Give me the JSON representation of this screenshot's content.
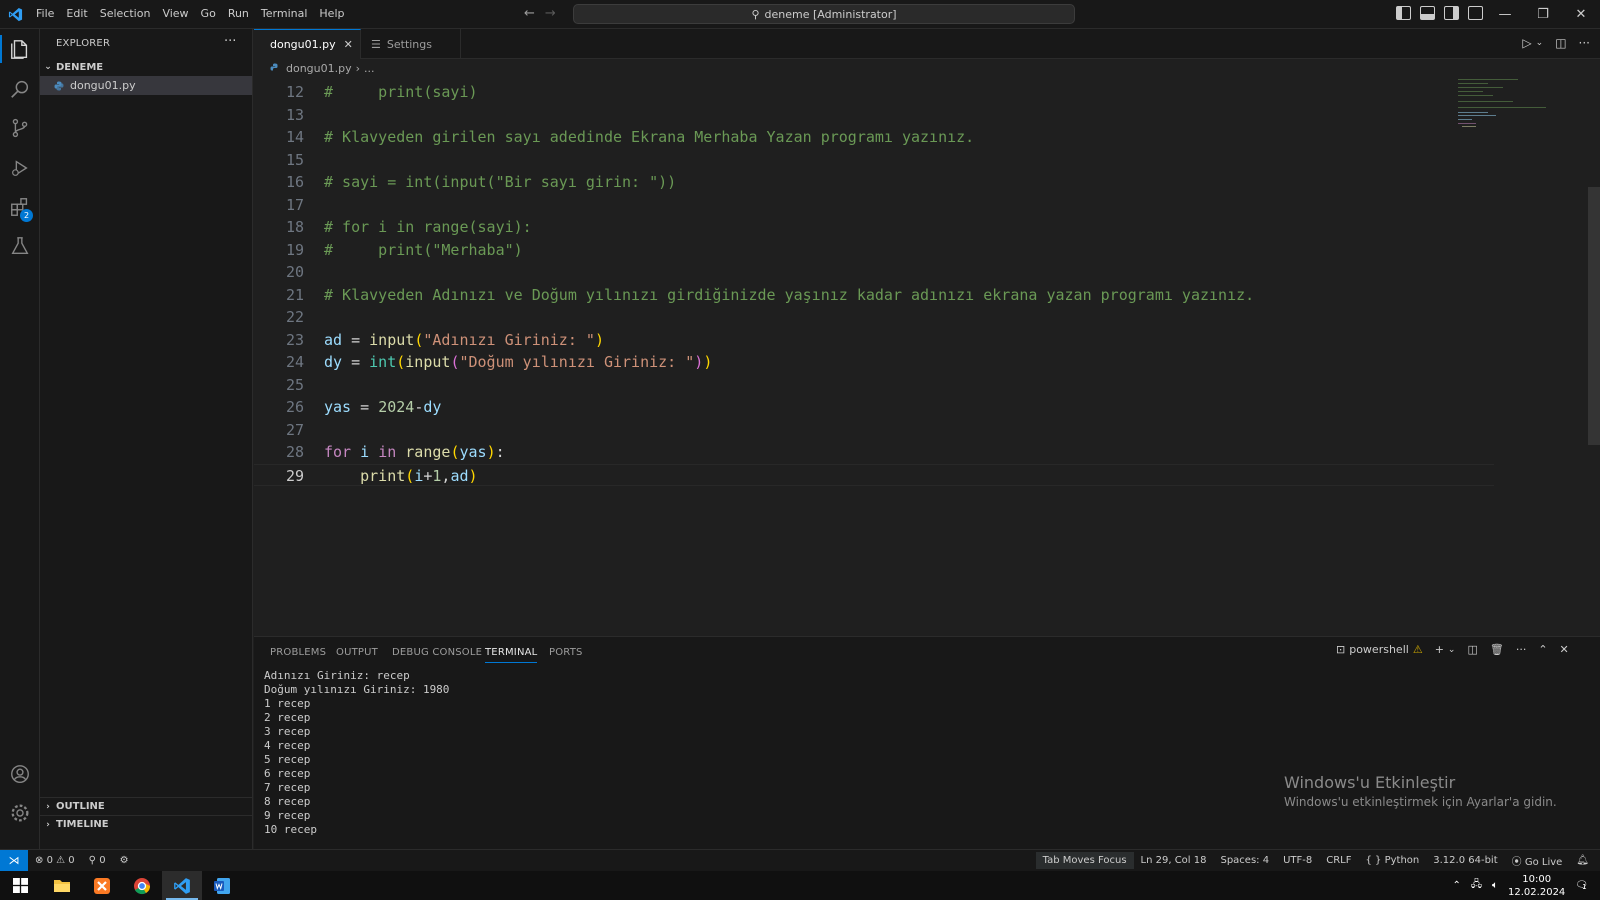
{
  "titlebar": {
    "menu": [
      "File",
      "Edit",
      "Selection",
      "View",
      "Go",
      "Run",
      "Terminal",
      "Help"
    ],
    "command_center": "deneme [Administrator]"
  },
  "sidebar": {
    "title": "EXPLORER",
    "folder": "DENEME",
    "files": [
      {
        "name": "dongu01.py"
      }
    ],
    "outline": "OUTLINE",
    "timeline": "TIMELINE"
  },
  "activity": {
    "extensions_badge": "2"
  },
  "tabs": [
    {
      "label": "dongu01.py",
      "active": true
    },
    {
      "label": "Settings",
      "active": false
    }
  ],
  "breadcrumb": {
    "file": "dongu01.py",
    "rest": "..."
  },
  "editor": {
    "lines": [
      {
        "n": "12",
        "text": "#     print(sayi)"
      },
      {
        "n": "13",
        "text": ""
      },
      {
        "n": "14",
        "text": "# Klavyeden girilen sayı adedinde Ekrana Merhaba Yazan programı yazınız."
      },
      {
        "n": "15",
        "text": ""
      },
      {
        "n": "16",
        "text": "# sayi = int(input(\"Bir sayı girin: \"))"
      },
      {
        "n": "17",
        "text": ""
      },
      {
        "n": "18",
        "text": "# for i in range(sayi):"
      },
      {
        "n": "19",
        "text": "#     print(\"Merhaba\")"
      },
      {
        "n": "20",
        "text": ""
      },
      {
        "n": "21",
        "text": "# Klavyeden Adınızı ve Doğum yılınızı girdiğinizde yaşınız kadar adınızı ekrana yazan programı yazınız."
      },
      {
        "n": "22",
        "text": ""
      },
      {
        "n": "23",
        "text": "ad = input(\"Adınızı Giriniz: \")"
      },
      {
        "n": "24",
        "text": "dy = int(input(\"Doğum yılınızı Giriniz: \"))"
      },
      {
        "n": "25",
        "text": ""
      },
      {
        "n": "26",
        "text": "yas = 2024-dy"
      },
      {
        "n": "27",
        "text": ""
      },
      {
        "n": "28",
        "text": "for i in range(yas):"
      },
      {
        "n": "29",
        "text": "    print(i+1,ad)"
      }
    ]
  },
  "panel": {
    "tabs": [
      "PROBLEMS",
      "OUTPUT",
      "DEBUG CONSOLE",
      "TERMINAL",
      "PORTS"
    ],
    "active_tab": "TERMINAL",
    "shell": "powershell",
    "terminal_lines": [
      "Adınızı Giriniz: recep",
      "Doğum yılınızı Giriniz: 1980",
      "1 recep",
      "2 recep",
      "3 recep",
      "4 recep",
      "5 recep",
      "6 recep",
      "7 recep",
      "8 recep",
      "9 recep",
      "10 recep"
    ]
  },
  "activation": {
    "title": "Windows'u Etkinleştir",
    "subtitle": "Windows'u etkinleştirmek için Ayarlar'a gidin."
  },
  "statusbar": {
    "errors": "0",
    "warnings": "0",
    "ports": "0",
    "tab_moves_focus": "Tab Moves Focus",
    "position": "Ln 29, Col 18",
    "spaces": "Spaces: 4",
    "encoding": "UTF-8",
    "eol": "CRLF",
    "language": "Python",
    "interpreter": "3.12.0 64-bit",
    "go_live": "Go Live"
  },
  "taskbar": {
    "time": "10:00",
    "date": "12.02.2024",
    "notifications": "1"
  },
  "colors": {
    "accent": "#0078d4",
    "comment": "#6a9955",
    "keyword": "#c586c0",
    "string": "#ce9178"
  }
}
